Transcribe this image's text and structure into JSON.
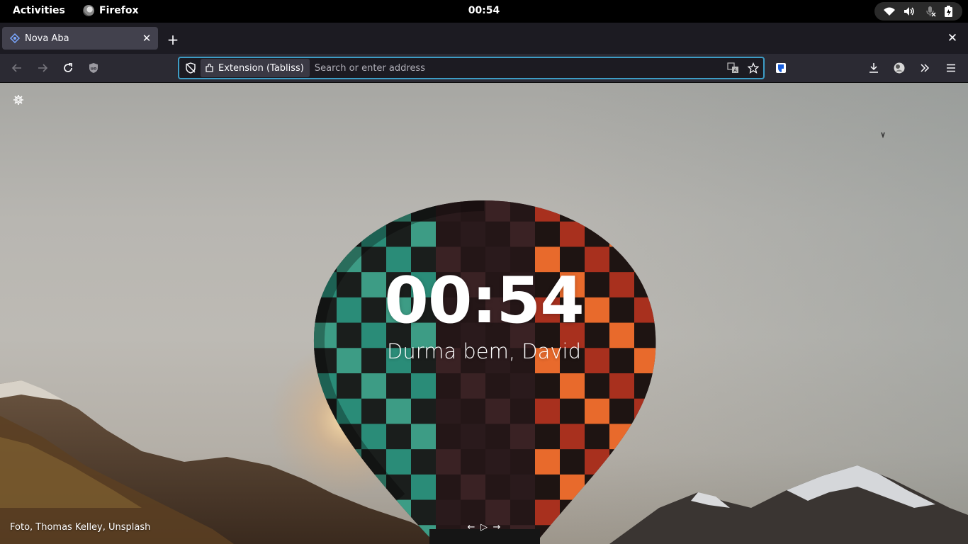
{
  "topbar": {
    "activities": "Activities",
    "app_name": "Firefox",
    "clock": "00:54",
    "tray_icons": [
      "wifi-icon",
      "volume-icon",
      "mic-muted-icon",
      "battery-icon"
    ]
  },
  "tabs": [
    {
      "title": "Nova Aba",
      "icon": "tabliss-icon"
    }
  ],
  "navbar": {
    "identity_label": "Extension (Tabliss)",
    "address_placeholder": "Search or enter address",
    "address_value": ""
  },
  "content": {
    "clock": "00:54",
    "greeting": "Durma bem, David",
    "credit": "Foto, Thomas Kelley, Unsplash"
  },
  "colors": {
    "chrome_dark": "#1c1b22",
    "toolbar": "#2b2a33",
    "tab_selected": "#42414d",
    "focus_ring": "#3d9dc6"
  }
}
